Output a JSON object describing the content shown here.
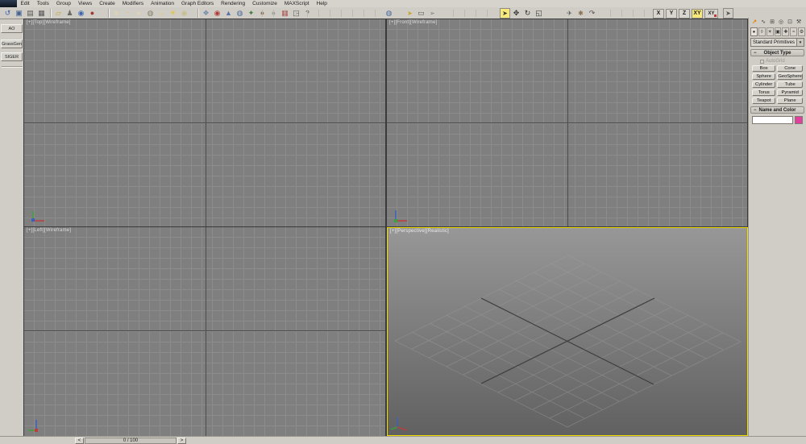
{
  "menu_bar": {
    "items": [
      "Edit",
      "Tools",
      "Group",
      "Views",
      "Create",
      "Modifiers",
      "Animation",
      "Graph Editors",
      "Rendering",
      "Customize",
      "MAXScript",
      "Help"
    ]
  },
  "toolbar": {
    "icons1": [
      {
        "name": "undo-icon",
        "glyph": "↺",
        "color": "#3f63ad"
      },
      {
        "name": "scene-explorer-icon",
        "glyph": "▣",
        "color": "#44618f"
      },
      {
        "name": "layer-manager-icon",
        "glyph": "▤",
        "color": "#555555"
      },
      {
        "name": "curve-editor-icon",
        "glyph": "▦",
        "color": "#555555"
      }
    ],
    "icons2": [
      {
        "name": "open-folder-icon",
        "glyph": "▱",
        "color": "#c9a227"
      },
      {
        "name": "biped-icon",
        "glyph": "♟",
        "color": "#6b6b6b"
      },
      {
        "name": "sound-icon",
        "glyph": "◉",
        "color": "#3f63ad"
      },
      {
        "name": "render-teapot-icon",
        "glyph": "●",
        "color": "#a23535"
      }
    ],
    "icons3": [
      {
        "name": "box-primitive-icon",
        "glyph": "■",
        "color": "#ddd3b4"
      },
      {
        "name": "dome-primitive-icon",
        "glyph": "◓",
        "color": "#d4c8a2"
      },
      {
        "name": "sphere-primitive-icon",
        "glyph": "●",
        "color": "#ded4b6"
      },
      {
        "name": "torus-primitive-icon",
        "glyph": "◍",
        "color": "#857d65"
      },
      {
        "name": "cone-primitive-icon",
        "glyph": "▲",
        "color": "#d6cbaa"
      },
      {
        "name": "omni-light-icon",
        "glyph": "☀",
        "color": "#e3c52f"
      },
      {
        "name": "geosphere-primitive-icon",
        "glyph": "◉",
        "color": "#c9bd8e"
      }
    ],
    "icons4": [
      {
        "name": "snapshot-icon",
        "glyph": "❖",
        "color": "#7189ab"
      },
      {
        "name": "material-icon",
        "glyph": "◉",
        "color": "#b03a3a"
      },
      {
        "name": "particles-icon",
        "glyph": "▲",
        "color": "#5a74aa"
      },
      {
        "name": "earth-icon",
        "glyph": "◍",
        "color": "#47699c"
      },
      {
        "name": "foliage-icon",
        "glyph": "✦",
        "color": "#3f7a3f"
      },
      {
        "name": "rock-icon",
        "glyph": "●",
        "color": "#8a6f52"
      },
      {
        "name": "gray-sphere-icon",
        "glyph": "●",
        "color": "#999999"
      },
      {
        "name": "schematic-view-icon",
        "glyph": "▦",
        "color": "#b05050"
      },
      {
        "name": "export-box-icon",
        "glyph": "◳",
        "color": "#555555"
      },
      {
        "name": "help-icon",
        "glyph": "?",
        "color": "#444444"
      }
    ],
    "icons5a": [
      {
        "name": "zoom-region-globe-icon",
        "glyph": "◍",
        "color": "#47699c"
      }
    ],
    "icons5b": [
      {
        "name": "pick-object-icon",
        "glyph": "➤",
        "color": "#c9a227"
      },
      {
        "name": "region-marquee-icon",
        "glyph": "▭",
        "color": "#555555"
      },
      {
        "name": "cursor-arrow-icon",
        "glyph": "➢",
        "color": "#777777"
      }
    ],
    "icons6": [
      {
        "name": "select-object-icon",
        "glyph": "➤",
        "color": "#333333"
      },
      {
        "name": "select-move-icon",
        "glyph": "✥",
        "color": "#333333"
      },
      {
        "name": "select-rotate-icon",
        "glyph": "↻",
        "color": "#333333"
      },
      {
        "name": "select-scale-icon",
        "glyph": "◱",
        "color": "#333333"
      }
    ],
    "icons7": [
      {
        "name": "align-icon",
        "glyph": "✈",
        "color": "#555555"
      },
      {
        "name": "pan-hand-icon",
        "glyph": "✱",
        "color": "#8a6f52"
      },
      {
        "name": "orbit-icon",
        "glyph": "↷",
        "color": "#555555"
      }
    ],
    "axis_constraints": {
      "x": "X",
      "y": "Y",
      "z": "Z",
      "xy": "XY",
      "active": "XY",
      "spinner_label": "XY"
    },
    "manipulate_glyph": "➤"
  },
  "side_tabs": {
    "items": [
      "AO",
      "GrassGen",
      "SIGER"
    ]
  },
  "viewports": {
    "top": {
      "label": "[+][Top][Wireframe]"
    },
    "front": {
      "label": "[+][Front][Wireframe]"
    },
    "left": {
      "label": "[+][Left][Wireframe]"
    },
    "perspective": {
      "label": "[+][Perspective][Realistic]"
    }
  },
  "command_panel": {
    "tabs": [
      {
        "name": "create",
        "glyph": "↗"
      },
      {
        "name": "modify",
        "glyph": "∿"
      },
      {
        "name": "hierarchy",
        "glyph": "⊞"
      },
      {
        "name": "motion",
        "glyph": "◎"
      },
      {
        "name": "display",
        "glyph": "⊡"
      },
      {
        "name": "utilities",
        "glyph": "⚒"
      }
    ],
    "categories": [
      {
        "name": "geometry",
        "glyph": "●"
      },
      {
        "name": "shapes",
        "glyph": "◊"
      },
      {
        "name": "lights",
        "glyph": "☀"
      },
      {
        "name": "cameras",
        "glyph": "▣"
      },
      {
        "name": "helpers",
        "glyph": "✚"
      },
      {
        "name": "space-warps",
        "glyph": "≈"
      },
      {
        "name": "systems",
        "glyph": "⚙"
      }
    ],
    "subcategory_dropdown": "Standard Primitives",
    "dropdown_arrow": "▼",
    "object_type": {
      "collapse": "−",
      "title": "Object Type",
      "autogrid_label": "AutoGrid",
      "buttons": [
        "Box",
        "Cone",
        "Sphere",
        "GeoSphere",
        "Cylinder",
        "Tube",
        "Torus",
        "Pyramid",
        "Teapot",
        "Plane"
      ]
    },
    "name_color": {
      "collapse": "−",
      "title": "Name and Color",
      "name_value": "",
      "swatch_color": "#e23fa0"
    }
  },
  "timeline": {
    "prev": "<",
    "next": ">",
    "frame": "0 / 100"
  },
  "colors": {
    "active_viewport_border": "#f2df00",
    "viewport_background": "#7f7f7f",
    "toolbar_active_highlight": "#f7e87a",
    "chrome": "#d0cdc6",
    "swatch": "#e23fa0"
  }
}
